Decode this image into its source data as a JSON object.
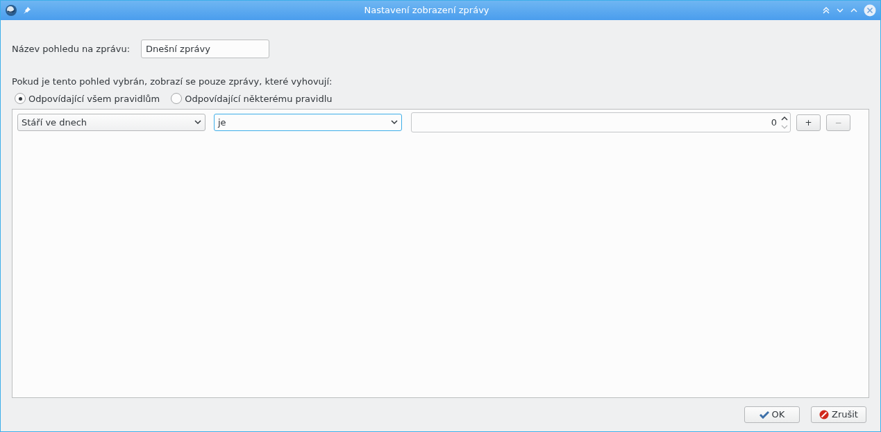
{
  "window": {
    "title": "Nastavení zobrazení zprávy"
  },
  "name_field": {
    "label": "Název pohledu na zprávu:",
    "value": "Dnešní zprávy"
  },
  "match": {
    "caption": "Pokud je tento pohled vybrán, zobrazí se pouze zprávy, které vyhovují:",
    "options": [
      {
        "label": "Odpovídající všem pravidlům",
        "selected": true
      },
      {
        "label": "Odpovídající některému pravidlu",
        "selected": false
      }
    ]
  },
  "rules": [
    {
      "field": "Stáří ve dnech",
      "operator": "je",
      "operator_focused": true,
      "value": "0",
      "add_label": "+",
      "remove_label": "−",
      "remove_disabled": true
    }
  ],
  "buttons": [
    {
      "label": "OK",
      "kind": "ok"
    },
    {
      "label": "Zrušit",
      "kind": "cancel"
    }
  ]
}
